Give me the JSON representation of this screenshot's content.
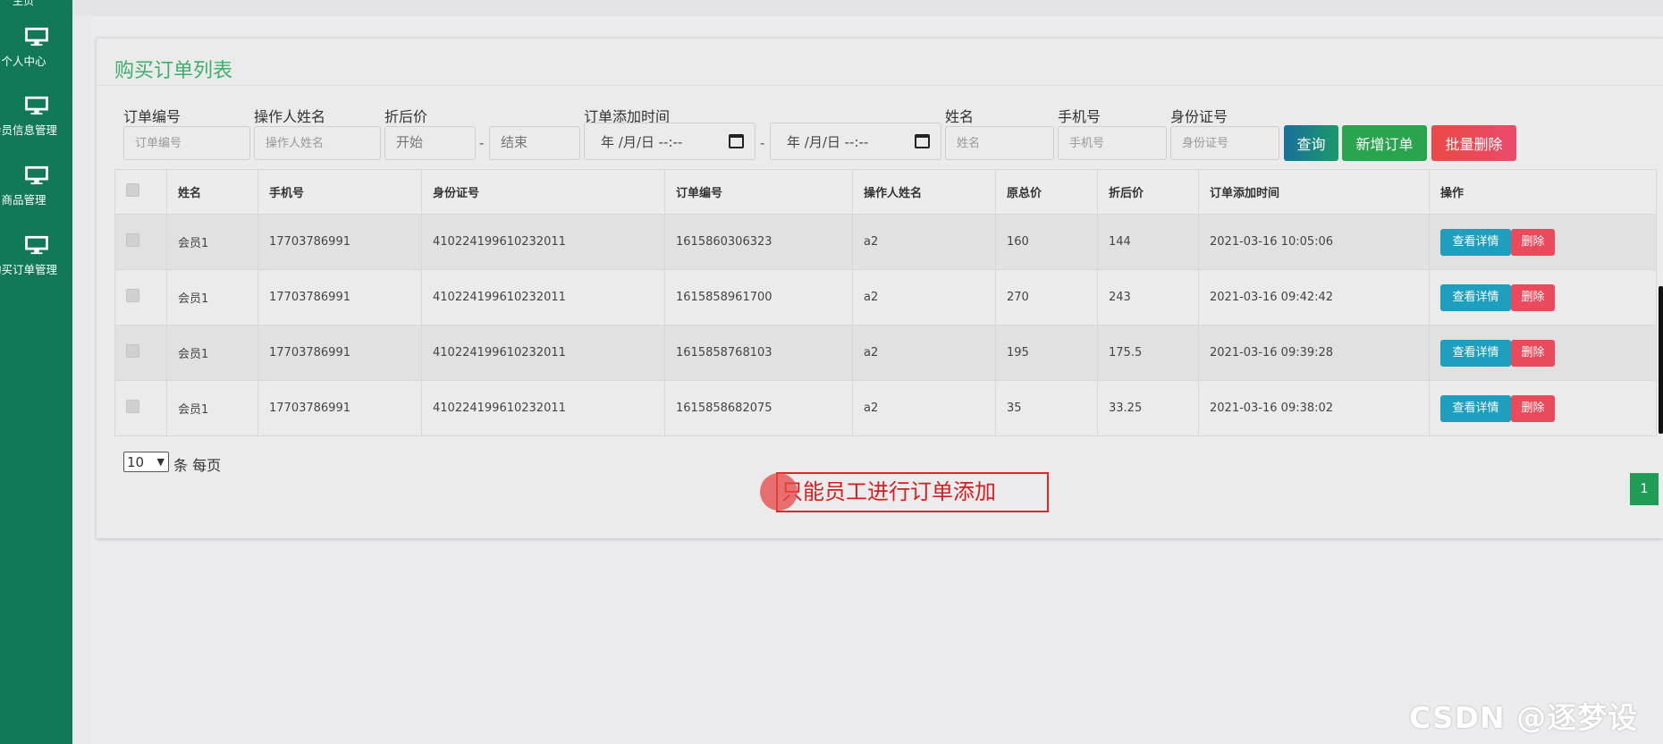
{
  "sidebar": {
    "top_label": "主页",
    "items": [
      {
        "label": "个人中心",
        "icon": "monitor-icon"
      },
      {
        "label": "会员信息管理",
        "icon": "monitor-icon"
      },
      {
        "label": "商品管理",
        "icon": "monitor-icon"
      },
      {
        "label": "购买订单管理",
        "icon": "monitor-icon"
      }
    ]
  },
  "page": {
    "title": "购买订单列表"
  },
  "filters": {
    "order_no": {
      "label": "订单编号",
      "placeholder": "订单编号"
    },
    "operator": {
      "label": "操作人姓名",
      "placeholder": "操作人姓名"
    },
    "discount": {
      "label": "折后价",
      "start_placeholder": "开始",
      "end_placeholder": "结束",
      "separator": "-"
    },
    "add_time": {
      "label": "订单添加时间",
      "start_value": "年 /月/日 --:--",
      "end_value": "年 /月/日 --:--",
      "separator": "-"
    },
    "name": {
      "label": "姓名",
      "placeholder": "姓名"
    },
    "phone": {
      "label": "手机号",
      "placeholder": "手机号"
    },
    "id_card": {
      "label": "身份证号",
      "placeholder": "身份证号"
    }
  },
  "toolbar": {
    "query_label": "查询",
    "add_label": "新增订单",
    "batch_delete_label": "批量删除"
  },
  "colors": {
    "sidebar": "#11795a",
    "title": "#3fae6c",
    "query_button": "#178a86",
    "add_button": "#2aa44f",
    "delete_button": "#ea4a5c",
    "view_button": "#1f9fc0"
  },
  "table": {
    "headers": [
      "姓名",
      "手机号",
      "身份证号",
      "订单编号",
      "操作人姓名",
      "原总价",
      "折后价",
      "订单添加时间",
      "操作"
    ],
    "rows": [
      {
        "name": "会员1",
        "phone": "17703786991",
        "id_card": "410224199610232011",
        "order_no": "1615860306323",
        "operator": "a2",
        "original": "160",
        "discount": "144",
        "time": "2021-03-16 10:05:06"
      },
      {
        "name": "会员1",
        "phone": "17703786991",
        "id_card": "410224199610232011",
        "order_no": "1615858961700",
        "operator": "a2",
        "original": "270",
        "discount": "243",
        "time": "2021-03-16 09:42:42"
      },
      {
        "name": "会员1",
        "phone": "17703786991",
        "id_card": "410224199610232011",
        "order_no": "1615858768103",
        "operator": "a2",
        "original": "195",
        "discount": "175.5",
        "time": "2021-03-16 09:39:28"
      },
      {
        "name": "会员1",
        "phone": "17703786991",
        "id_card": "410224199610232011",
        "order_no": "1615858682075",
        "operator": "a2",
        "original": "35",
        "discount": "33.25",
        "time": "2021-03-16 09:38:02"
      }
    ],
    "view_label": "查看详情",
    "delete_label": "删除"
  },
  "pagination": {
    "page_size": "10",
    "page_size_suffix": "条 每页",
    "current_page": "1"
  },
  "annotation": {
    "text": "只能员工进行订单添加"
  },
  "watermark": "CSDN @逐梦设计"
}
